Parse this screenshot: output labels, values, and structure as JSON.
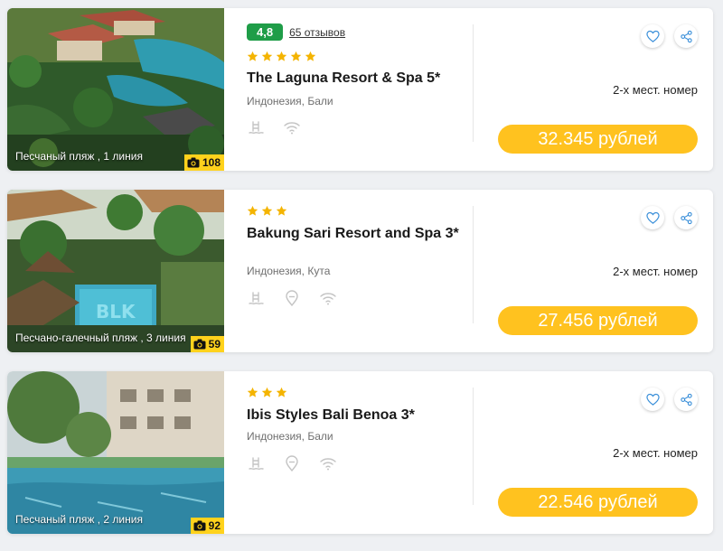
{
  "hotels": [
    {
      "rating": "4,8",
      "reviews": "65 отзывов",
      "stars": 5,
      "name": "The Laguna Resort & Spa 5*",
      "location": "Индонезия, Бали",
      "beach": "Песчаный пляж , 1 линия",
      "photo_count": "108",
      "room_type": "2-х мест. номер",
      "price": "32.345 рублей",
      "amenities": [
        "pool-icon",
        "wifi-icon"
      ]
    },
    {
      "stars": 3,
      "name": "Bakung Sari Resort and Spa 3*",
      "location": "Индонезия, Кута",
      "beach": "Песчано-галечный пляж , 3 линия",
      "photo_count": "59",
      "room_type": "2-х мест. номер",
      "price": "27.456 рублей",
      "amenities": [
        "pool-icon",
        "location-pin-icon",
        "wifi-icon"
      ]
    },
    {
      "stars": 3,
      "name": "Ibis Styles Bali Benoa 3*",
      "location": "Индонезия, Бали",
      "beach": "Песчаный пляж , 2 линия",
      "photo_count": "92",
      "room_type": "2-х мест. номер",
      "price": "22.546 рублей",
      "amenities": [
        "pool-icon",
        "location-pin-icon",
        "wifi-icon"
      ]
    }
  ],
  "colors": {
    "price_button": "#ffc21f",
    "star": "#f4b400",
    "rating_badge": "#1f9d48",
    "photo_count_badge": "#ffd21c"
  }
}
